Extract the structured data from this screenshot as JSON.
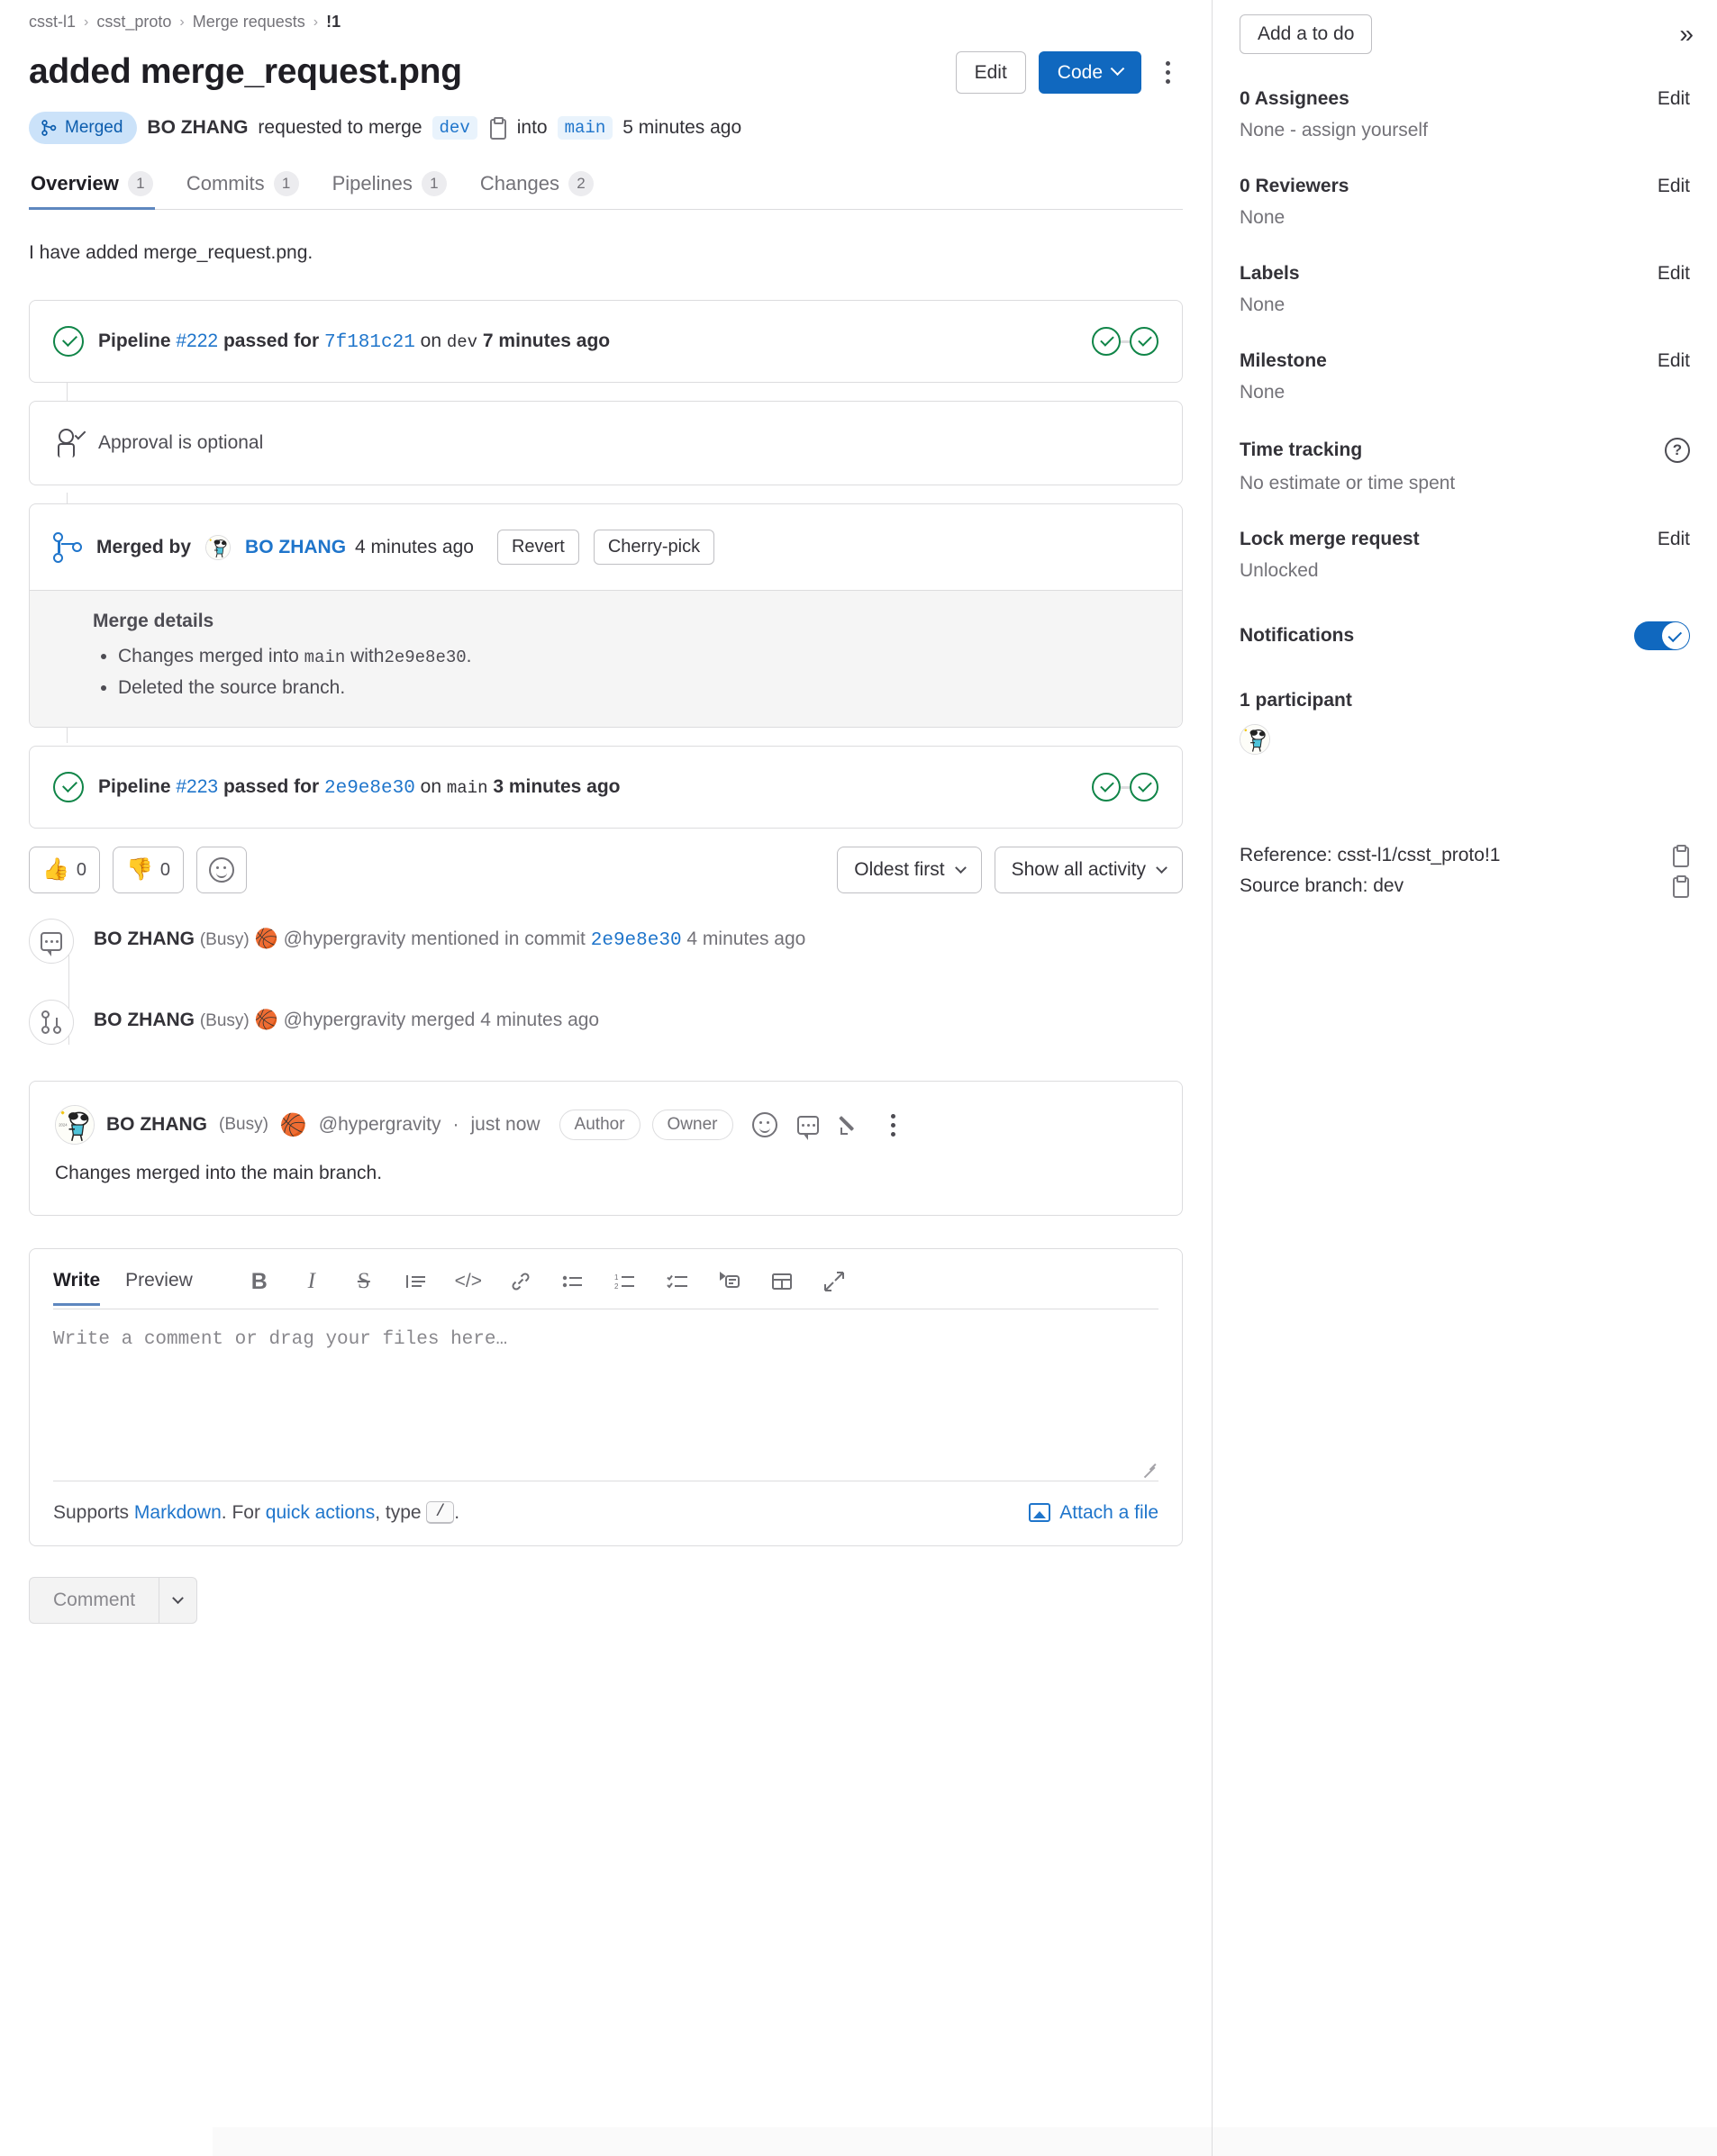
{
  "breadcrumb": [
    "csst-l1",
    "csst_proto",
    "Merge requests",
    "!1"
  ],
  "header": {
    "title": "added merge_request.png",
    "edit_label": "Edit",
    "code_label": "Code",
    "status_badge": "Merged",
    "status_author": "BO ZHANG",
    "status_requested": "requested to merge",
    "source_branch": "dev",
    "status_into": "into",
    "target_branch": "main",
    "status_time": "5 minutes ago"
  },
  "tabs": [
    {
      "label": "Overview",
      "count": "1",
      "active": true
    },
    {
      "label": "Commits",
      "count": "1",
      "active": false
    },
    {
      "label": "Pipelines",
      "count": "1",
      "active": false
    },
    {
      "label": "Changes",
      "count": "2",
      "active": false
    }
  ],
  "description": "I have added merge_request.png.",
  "pipeline_top": {
    "prefix": "Pipeline",
    "id": "#222",
    "status": "passed for",
    "sha": "7f181c21",
    "on": "on",
    "branch": "dev",
    "time": "7 minutes ago"
  },
  "approval": {
    "text": "Approval is optional"
  },
  "merged": {
    "label": "Merged by",
    "author": "BO ZHANG",
    "time": "4 minutes ago",
    "revert_label": "Revert",
    "cherry_pick_label": "Cherry-pick",
    "details_title": "Merge details",
    "detail_1_prefix": "Changes merged into",
    "detail_1_branch": "main",
    "detail_1_mid": "with",
    "detail_1_sha": "2e9e8e30",
    "detail_2": "Deleted the source branch."
  },
  "pipeline_bottom": {
    "prefix": "Pipeline",
    "id": "#223",
    "status": "passed for",
    "sha": "2e9e8e30",
    "on": "on",
    "branch": "main",
    "time": "3 minutes ago"
  },
  "reactions": {
    "thumbsup_emoji": "👍",
    "thumbsup_count": "0",
    "thumbsdown_emoji": "👎",
    "thumbsdown_count": "0",
    "sort_label": "Oldest first",
    "filter_label": "Show all activity"
  },
  "activity": [
    {
      "icon": "comment-icon",
      "name": "BO ZHANG",
      "busy": "(Busy)",
      "emoji": "🏀",
      "handle": "@hypergravity",
      "action": "mentioned in commit",
      "sha": "2e9e8e30",
      "time": "4 minutes ago"
    },
    {
      "icon": "merge-icon",
      "name": "BO ZHANG",
      "busy": "(Busy)",
      "emoji": "🏀",
      "handle": "@hypergravity",
      "action": "merged",
      "sha": "",
      "time": "4 minutes ago"
    }
  ],
  "comment": {
    "name": "BO ZHANG",
    "busy": "(Busy)",
    "emoji": "🏀",
    "handle": "@hypergravity",
    "sep": "·",
    "time": "just now",
    "badge_author": "Author",
    "badge_owner": "Owner",
    "body": "Changes merged into the main branch."
  },
  "editor": {
    "tab_write": "Write",
    "tab_preview": "Preview",
    "toolbar": [
      {
        "name": "bold-icon",
        "glyph": "B"
      },
      {
        "name": "italic-icon",
        "glyph": "I"
      },
      {
        "name": "strikethrough-icon",
        "glyph": "S"
      },
      {
        "name": "quote-icon",
        "glyph": "≡"
      },
      {
        "name": "code-icon",
        "glyph": "</>"
      },
      {
        "name": "link-icon",
        "glyph": "🔗"
      },
      {
        "name": "bullet-list-icon",
        "glyph": "☰"
      },
      {
        "name": "numbered-list-icon",
        "glyph": "☰"
      },
      {
        "name": "task-list-icon",
        "glyph": "☰"
      },
      {
        "name": "collapsible-section-icon",
        "glyph": "▶"
      },
      {
        "name": "table-icon",
        "glyph": "⌸"
      },
      {
        "name": "fullscreen-icon",
        "glyph": "⤡"
      }
    ],
    "placeholder": "Write a comment or drag your files here…",
    "supports_prefix": "Supports",
    "markdown_link": "Markdown",
    "supports_mid": ". For",
    "quick_actions_link": "quick actions",
    "supports_type": ", type",
    "slash_key": "/",
    "supports_suffix": ".",
    "attach_label": "Attach a file",
    "submit_label": "Comment"
  },
  "sidebar": {
    "todo_label": "Add a to do",
    "collapse_icon": "»",
    "blocks": [
      {
        "title": "0 Assignees",
        "action": "Edit",
        "value": "None - assign yourself"
      },
      {
        "title": "0 Reviewers",
        "action": "Edit",
        "value": "None"
      },
      {
        "title": "Labels",
        "action": "Edit",
        "value": "None"
      },
      {
        "title": "Milestone",
        "action": "Edit",
        "value": "None"
      },
      {
        "title": "Time tracking",
        "action": "help-icon",
        "value": "No estimate or time spent"
      },
      {
        "title": "Lock merge request",
        "action": "Edit",
        "value": "Unlocked"
      }
    ],
    "notifications_label": "Notifications",
    "notifications_on": true,
    "participants_label": "1 participant",
    "reference_text": "Reference: csst-l1/csst_proto!1",
    "source_branch_text": "Source branch: dev"
  },
  "colors": {
    "accent": "#1068bf",
    "link": "#1f75cb",
    "success": "#108548",
    "merged_badge_bg": "#cbe2f9",
    "merged_badge_fg": "#0b5cad",
    "border": "#dcdcde",
    "muted": "#737278"
  }
}
